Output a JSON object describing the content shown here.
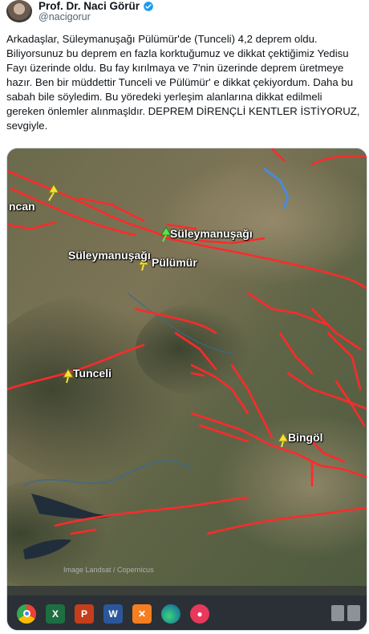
{
  "author": {
    "display_name": "Prof. Dr. Naci Görür",
    "handle": "@nacigorur"
  },
  "tweet": {
    "text": "Arkadaşlar, Süleymanuşağı Pülümür'de (Tunceli) 4,2 deprem oldu.\nBiliyorsunuz bu deprem en fazla korktuğumuz ve dikkat çektiğimiz Yedisu Fayı üzerinde oldu. Bu fay kırılmaya ve 7'nin üzerinde deprem üretmeye hazır. Ben bir müddettir Tunceli ve Pülümür' e dikkat çekiyordum. Daha bu sabah bile söyledim. Bu yöredeki yerleşim alanlarına dikkat edilmeli gereken önlemler alınmaşldır. DEPREM DİRENÇLİ KENTLER İSTİYORUZ, sevgiyle."
  },
  "map": {
    "labels": {
      "erzincan": "ncan",
      "suleymanusagi_top": "Süleymanuşağı",
      "suleymanusagi_left": "Süleymanuşağı",
      "pulumur": "Pülümür",
      "tunceli": "Tunceli",
      "bingol": "Bingöl"
    },
    "credit": "Image Landsat / Copernicus",
    "fault_color": "#ff2a2a",
    "pin_yellow": "#f5e13a",
    "pin_green": "#5be34a"
  },
  "taskbar": {
    "icons": [
      "chrome-icon",
      "excel-icon",
      "powerpoint-icon",
      "word-icon",
      "xampp-icon",
      "edge-icon",
      "app-icon"
    ]
  }
}
